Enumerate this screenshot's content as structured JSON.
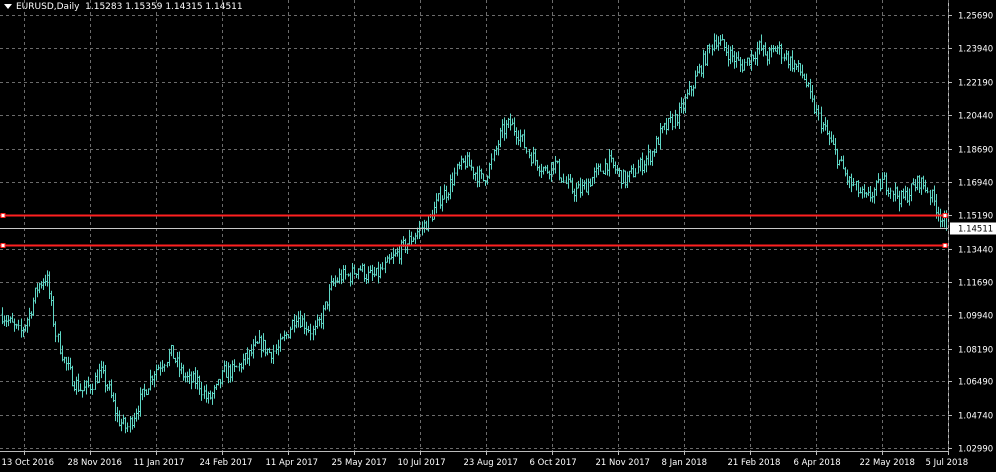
{
  "header": {
    "symbol": "EURUSD,Daily",
    "open": "1.15283",
    "high": "1.15359",
    "low": "1.14315",
    "close": "1.14511"
  },
  "colors": {
    "background": "#000000",
    "grid": "#6b6b6b",
    "candles": "#5fd7c6",
    "level_lines": "#ff2020",
    "text": "#ffffff",
    "price_label_bg": "#ffffff",
    "price_label_fg": "#000000"
  },
  "chart_data": {
    "type": "candlestick",
    "instrument": "EURUSD",
    "timeframe": "Daily",
    "ylim": [
      1.0299,
      1.2569
    ],
    "y_ticks": [
      "1.25690",
      "1.23940",
      "1.22190",
      "1.20440",
      "1.18690",
      "1.16940",
      "1.15190",
      "1.13440",
      "1.11690",
      "1.09940",
      "1.08190",
      "1.06490",
      "1.04740",
      "1.02990"
    ],
    "x_ticks": [
      "13 Oct 2016",
      "28 Nov 2016",
      "11 Jan 2017",
      "24 Feb 2017",
      "11 Apr 2017",
      "25 May 2017",
      "10 Jul 2017",
      "23 Aug 2017",
      "6 Oct 2017",
      "21 Nov 2017",
      "8 Jan 2018",
      "21 Feb 2018",
      "6 Apr 2018",
      "22 May 2018",
      "5 Jul 2018"
    ],
    "current_price": 1.14511,
    "horizontal_levels": [
      1.1519,
      1.1365
    ],
    "series": [
      {
        "approx_close": [
          1.1,
          1.095,
          1.09,
          1.1,
          1.115,
          1.12,
          1.09,
          1.075,
          1.065,
          1.06,
          1.063,
          1.07,
          1.06,
          1.045,
          1.04,
          1.05,
          1.06,
          1.07,
          1.075,
          1.08,
          1.07,
          1.065,
          1.065,
          1.055,
          1.06,
          1.07,
          1.07,
          1.075,
          1.08,
          1.085,
          1.08,
          1.082,
          1.09,
          1.1,
          1.095,
          1.09,
          1.1,
          1.115,
          1.12,
          1.12,
          1.125,
          1.12,
          1.12,
          1.125,
          1.13,
          1.135,
          1.14,
          1.145,
          1.15,
          1.16,
          1.165,
          1.175,
          1.18,
          1.175,
          1.17,
          1.18,
          1.195,
          1.2,
          1.195,
          1.185,
          1.18,
          1.175,
          1.18,
          1.17,
          1.165,
          1.165,
          1.17,
          1.175,
          1.18,
          1.175,
          1.17,
          1.175,
          1.18,
          1.185,
          1.195,
          1.2,
          1.205,
          1.215,
          1.225,
          1.235,
          1.245,
          1.24,
          1.235,
          1.23,
          1.235,
          1.24,
          1.235,
          1.24,
          1.235,
          1.23,
          1.225,
          1.21,
          1.2,
          1.19,
          1.18,
          1.17,
          1.165,
          1.16,
          1.165,
          1.17,
          1.165,
          1.16,
          1.165,
          1.17,
          1.165,
          1.155,
          1.14511
        ]
      }
    ]
  }
}
